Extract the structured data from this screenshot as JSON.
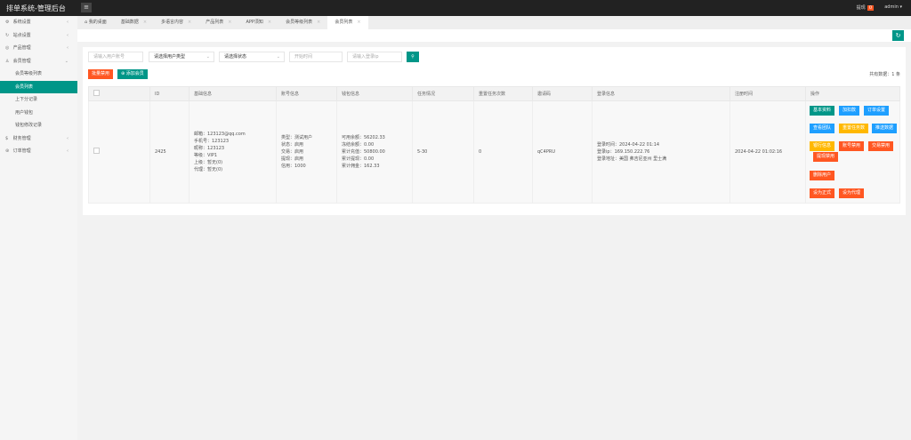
{
  "header": {
    "title": "排单系统-管理后台",
    "notice_label": "提现",
    "notice_count": "0",
    "user": "admin"
  },
  "sidebar": {
    "items": [
      {
        "label": "系统设置",
        "icon": "gear-icon"
      },
      {
        "label": "站点设置",
        "icon": "refresh-icon"
      },
      {
        "label": "产品管理",
        "icon": "product-icon"
      },
      {
        "label": "会员管理",
        "icon": "user-icon"
      },
      {
        "label": "财务管理",
        "icon": "dollar-icon"
      },
      {
        "label": "订单管理",
        "icon": "order-icon"
      }
    ],
    "sub_items": [
      "会员等级列表",
      "会员列表",
      "上下分记录",
      "用户钱包",
      "钱包修改记录"
    ]
  },
  "tabs": [
    "我的桌面",
    "基础数据",
    "多语言内容",
    "产品列表",
    "APP须知",
    "会员等级列表",
    "会员列表"
  ],
  "filters": {
    "account_placeholder": "请输入用户账号",
    "user_type": "请选择用户类型",
    "status": "请选择状态",
    "start_time_placeholder": "开始时间",
    "ip_placeholder": "请输入登录ip"
  },
  "actions": {
    "batch_disable": "批量禁用",
    "add_member": "添加会员"
  },
  "total": "共有数据：1 条",
  "colors": {
    "accent": "#009688",
    "blue": "#1e9fff",
    "yellow": "#ffb800",
    "red": "#ff5722"
  },
  "table": {
    "headers": [
      "ID",
      "基础信息",
      "账号信息",
      "钱包信息",
      "任务情况",
      "重置任务次数",
      "邀请码",
      "登录信息",
      "注册时间",
      "操作"
    ],
    "row": {
      "id": "2425",
      "basic": [
        "邮箱：123123@qq.com",
        "手机号：123123",
        "昵称：123123",
        "等级：VIP1",
        "上级：暂无(0)",
        "代理：暂无(0)"
      ],
      "account": [
        "类型：测试用户",
        "状态：启用",
        "交易：启用",
        "提现：启用",
        "信用：1000"
      ],
      "wallet": [
        "可用余额：56202.33",
        "冻结余额：0.00",
        "累计充值：50800.00",
        "累计提现：0.00",
        "累计佣金：162.33"
      ],
      "task": "5-30",
      "reset_count": "0",
      "invite": "qC4PRU",
      "login": [
        "登录时间：2024-04-22 01:14",
        "登录ip：169.150.222.76",
        "登录地址：美国 弗吉尼亚州 里士满"
      ],
      "register": "2024-04-22 01:02:16",
      "ops": [
        "基本资料",
        "加扣款",
        "订单设置",
        "查看团队",
        "重置任务数",
        "推送数据",
        "银行信息",
        "账号禁用",
        "交易禁用",
        "提现禁用",
        "删除用户",
        "设为正式",
        "设为代理"
      ]
    }
  }
}
